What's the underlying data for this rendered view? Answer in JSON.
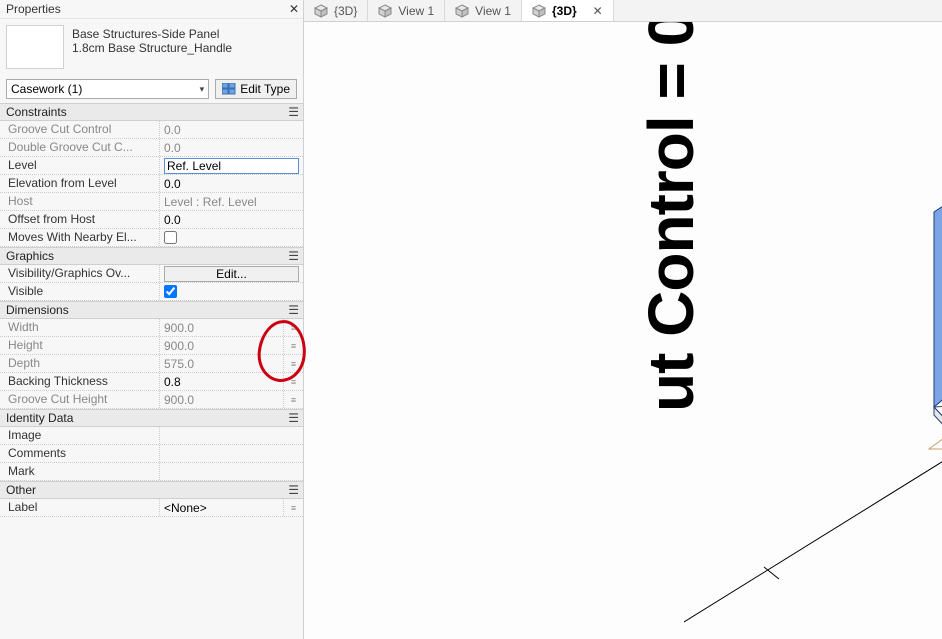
{
  "properties_title": "Properties",
  "type": {
    "line1": "Base Structures-Side Panel",
    "line2": "1.8cm Base Structure_Handle"
  },
  "selector": {
    "label": "Casework (1)"
  },
  "edit_type": "Edit Type",
  "groups": {
    "constraints": "Constraints",
    "graphics": "Graphics",
    "dimensions": "Dimensions",
    "identity": "Identity Data",
    "other": "Other"
  },
  "rows": {
    "groove_cut_control": {
      "label": "Groove Cut Control",
      "value": "0.0"
    },
    "double_groove_cut": {
      "label": "Double Groove Cut C...",
      "value": "0.0"
    },
    "level": {
      "label": "Level",
      "value": "Ref. Level"
    },
    "elev_from_level": {
      "label": "Elevation from Level",
      "value": "0.0"
    },
    "host": {
      "label": "Host",
      "value": "Level : Ref. Level"
    },
    "offset_from_host": {
      "label": "Offset from Host",
      "value": "0.0"
    },
    "moves_with_nearby": {
      "label": "Moves With Nearby El..."
    },
    "vis_graphics_override": {
      "label": "Visibility/Graphics Ov...",
      "value": "Edit..."
    },
    "visible": {
      "label": "Visible"
    },
    "width": {
      "label": "Width",
      "value": "900.0"
    },
    "height": {
      "label": "Height",
      "value": "900.0"
    },
    "depth": {
      "label": "Depth",
      "value": "575.0"
    },
    "backing_thickness": {
      "label": "Backing Thickness",
      "value": "0.8"
    },
    "groove_cut_height": {
      "label": "Groove Cut Height",
      "value": "900.0"
    },
    "image": {
      "label": "Image",
      "value": ""
    },
    "comments": {
      "label": "Comments",
      "value": ""
    },
    "mark": {
      "label": "Mark",
      "value": ""
    },
    "label": {
      "label": "Label",
      "value": "<None>"
    }
  },
  "tabs": [
    {
      "label": "{3D}",
      "active": false
    },
    {
      "label": "View 1",
      "active": false
    },
    {
      "label": "View 1",
      "active": false
    },
    {
      "label": "{3D}",
      "active": true
    }
  ],
  "annotation_text": "ut Control = 0"
}
